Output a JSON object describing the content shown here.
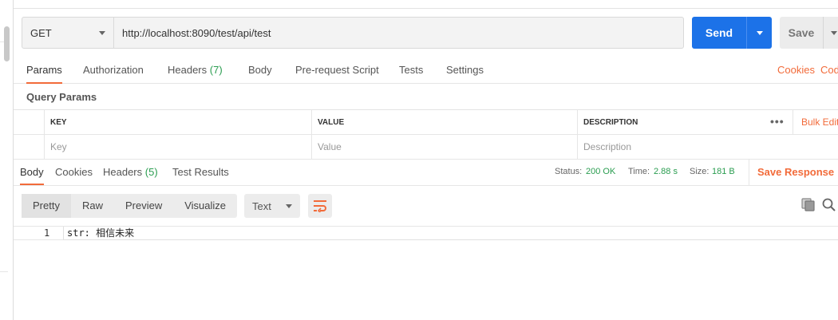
{
  "request": {
    "method": "GET",
    "url": "http://localhost:8090/test/api/test",
    "send_label": "Send",
    "save_label": "Save"
  },
  "request_tabs": [
    {
      "label": "Params",
      "count": ""
    },
    {
      "label": "Authorization",
      "count": ""
    },
    {
      "label": "Headers",
      "count": "(7)"
    },
    {
      "label": "Body",
      "count": ""
    },
    {
      "label": "Pre-request Script",
      "count": ""
    },
    {
      "label": "Tests",
      "count": ""
    },
    {
      "label": "Settings",
      "count": ""
    }
  ],
  "links": {
    "cookies": "Cookies",
    "code": "Code"
  },
  "query_params": {
    "title": "Query Params",
    "headers": {
      "key": "KEY",
      "value": "VALUE",
      "description": "DESCRIPTION"
    },
    "placeholders": {
      "key": "Key",
      "value": "Value",
      "description": "Description"
    },
    "menu": "•••",
    "bulk_edit": "Bulk Edit"
  },
  "response": {
    "tabs": [
      {
        "label": "Body",
        "count": ""
      },
      {
        "label": "Cookies",
        "count": ""
      },
      {
        "label": "Headers",
        "count": "(5)"
      },
      {
        "label": "Test Results",
        "count": ""
      }
    ],
    "status_label": "Status:",
    "status_value": "200 OK",
    "time_label": "Time:",
    "time_value": "2.88 s",
    "size_label": "Size:",
    "size_value": "181 B",
    "save_response": "Save Response"
  },
  "viewer": {
    "modes": [
      "Pretty",
      "Raw",
      "Preview",
      "Visualize"
    ],
    "format": "Text",
    "lines": [
      {
        "number": "1",
        "text": "str: 相信未来"
      }
    ]
  },
  "colors": {
    "accent": "#f26b3a",
    "send": "#1c72e8",
    "success": "#2a9d50"
  }
}
